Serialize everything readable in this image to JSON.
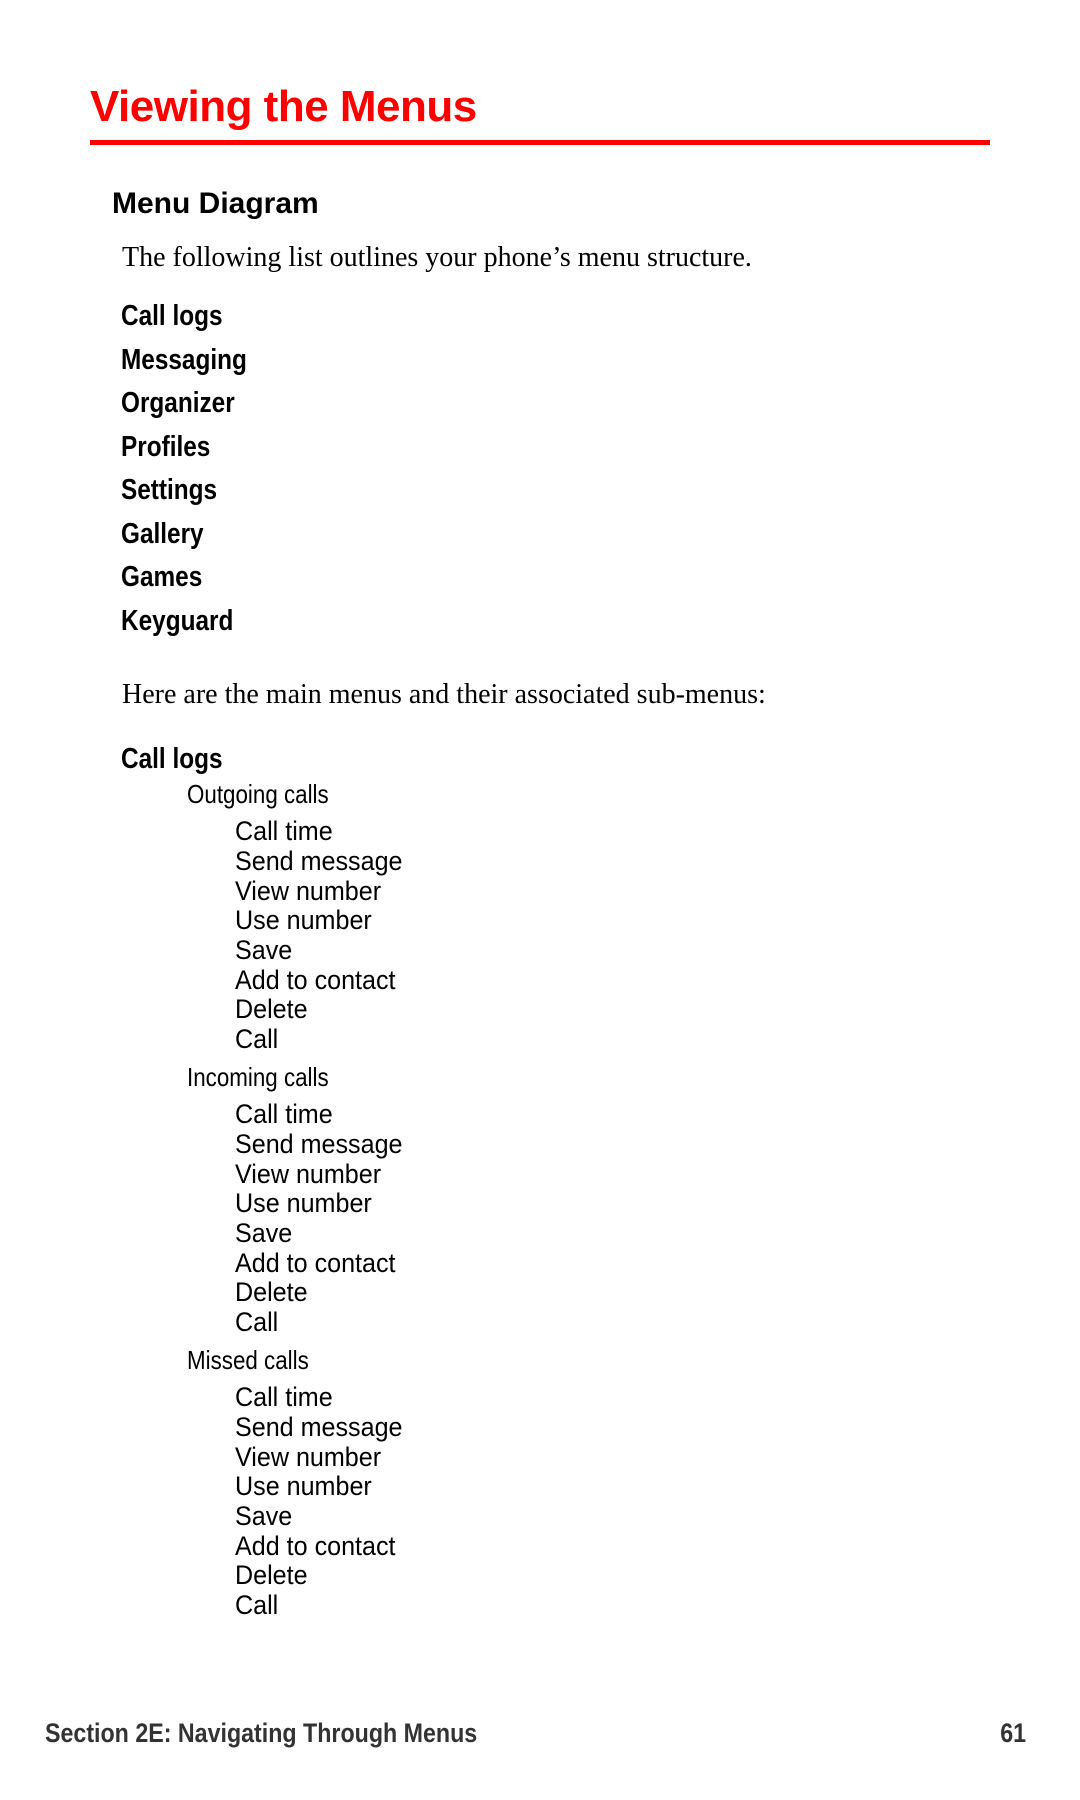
{
  "page": {
    "title": "Viewing the Menus",
    "accent_color": "#ff0000",
    "section_heading": "Menu Diagram",
    "intro": "The following list outlines your phone’s menu structure.",
    "main_menus": [
      "Call logs",
      "Messaging",
      "Organizer",
      "Profiles",
      "Settings",
      "Gallery",
      "Games",
      "Keyguard"
    ],
    "submenu_intro": "Here are the main menus and their associated sub-menus:",
    "detail": {
      "menu": "Call logs",
      "groups": [
        {
          "label": "Outgoing calls",
          "items": [
            "Call time",
            "Send message",
            "View number",
            "Use number",
            "Save",
            "Add to contact",
            "Delete",
            "Call"
          ]
        },
        {
          "label": "Incoming calls",
          "items": [
            "Call time",
            "Send message",
            "View number",
            "Use number",
            "Save",
            "Add to contact",
            "Delete",
            "Call"
          ]
        },
        {
          "label": "Missed calls",
          "items": [
            "Call time",
            "Send message",
            "View number",
            "Use number",
            "Save",
            "Add to contact",
            "Delete",
            "Call"
          ]
        }
      ]
    },
    "footer": {
      "section": "Section 2E: Navigating Through Menus",
      "page_number": "61"
    }
  }
}
